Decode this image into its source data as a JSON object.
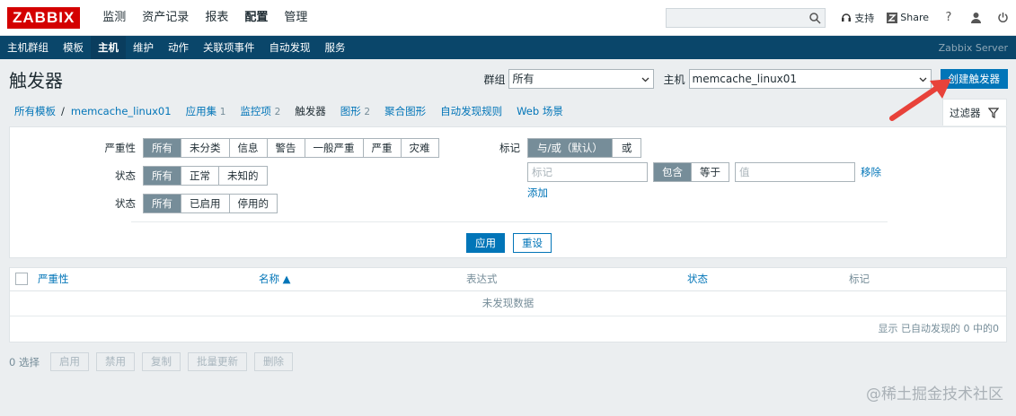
{
  "top": {
    "logo": "ZABBIX",
    "menu": [
      "监测",
      "资产记录",
      "报表",
      "配置",
      "管理"
    ],
    "search_value": "",
    "support_label": "支持",
    "share_label": "Share",
    "help_label": "?"
  },
  "subnav": {
    "items": [
      "主机群组",
      "模板",
      "主机",
      "维护",
      "动作",
      "关联项事件",
      "自动发现",
      "服务"
    ],
    "active_index": 2,
    "server_name": "Zabbix Server"
  },
  "header": {
    "title": "触发器",
    "group_label": "群组",
    "group_value": "所有",
    "host_label": "主机",
    "host_value": "memcache_linux01",
    "create_button": "创建触发器"
  },
  "breadcrumb": {
    "all_templates": "所有模板",
    "host": "memcache_linux01",
    "apps_label": "应用集",
    "apps_count": "1",
    "items_label": "监控项",
    "items_count": "2",
    "triggers_label": "触发器",
    "graphs_label": "图形",
    "graphs_count": "2",
    "screens_label": "聚合图形",
    "discovery_label": "自动发现规则",
    "web_label": "Web 场景",
    "filter_tab": "过滤器"
  },
  "filter": {
    "severity_label": "严重性",
    "severity_options": [
      "所有",
      "未分类",
      "信息",
      "警告",
      "一般严重",
      "严重",
      "灾难"
    ],
    "state_label": "状态",
    "state_options": [
      "所有",
      "正常",
      "未知的"
    ],
    "status_label": "状态",
    "status_options": [
      "所有",
      "已启用",
      "停用的"
    ],
    "tags_label": "标记",
    "tags_mode_options": [
      "与/或（默认）",
      "或"
    ],
    "tag_placeholder": "标记",
    "tag_op_options": [
      "包含",
      "等于"
    ],
    "value_placeholder": "值",
    "remove_label": "移除",
    "add_label": "添加",
    "apply_label": "应用",
    "reset_label": "重设"
  },
  "table": {
    "col_severity": "严重性",
    "col_name": "名称 ▲",
    "col_expression": "表达式",
    "col_status": "状态",
    "col_tags": "标记",
    "no_data": "未发现数据",
    "footer": "显示 已自动发现的 0 中的0"
  },
  "actions": {
    "selected": "0 选择",
    "buttons": [
      "启用",
      "禁用",
      "复制",
      "批量更新",
      "删除"
    ]
  },
  "watermark": "@稀土掘金技术社区",
  "colors": {
    "brand_red": "#d40000",
    "subnav_bg": "#0a466a",
    "primary_blue": "#0275b8",
    "segment_active": "#768d99",
    "arrow_red": "#e8423a"
  }
}
